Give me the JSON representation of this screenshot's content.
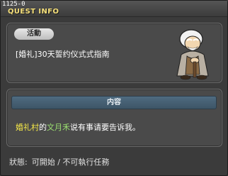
{
  "window": {
    "id": "1125-0",
    "title": "QUEST INFO"
  },
  "quest": {
    "category_label": "活動",
    "name": "[婚礼]30天誓约仪式式指南",
    "npc_icon": "old-man-npc-portrait"
  },
  "content": {
    "section_label": "内容",
    "location": "婚礼村",
    "particle": "的",
    "npc_name": "文月禾",
    "message": "说有事请要告诉我。"
  },
  "status": {
    "label": "狀態:",
    "value": "可開始 / 不可執行任務"
  },
  "colors": {
    "title_text": "#f6e07a",
    "location_highlight": "#f7ea48",
    "npc_highlight": "#9be070",
    "section_header": "#4f6b80"
  }
}
